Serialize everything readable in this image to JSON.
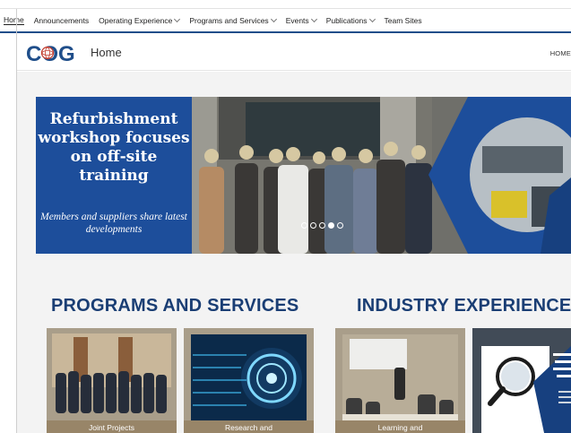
{
  "topnav": {
    "items": [
      {
        "label": "Home",
        "dropdown": false
      },
      {
        "label": "Announcements",
        "dropdown": false
      },
      {
        "label": "Operating Experience",
        "dropdown": true
      },
      {
        "label": "Programs and Services",
        "dropdown": true
      },
      {
        "label": "Events",
        "dropdown": true
      },
      {
        "label": "Publications",
        "dropdown": true
      },
      {
        "label": "Team Sites",
        "dropdown": false
      }
    ]
  },
  "header": {
    "logo_text": "COG",
    "title": "Home",
    "right_link": "HOME"
  },
  "hero": {
    "headline": "Refurbishment workshop focuses on off-site training",
    "subline": "Members and suppliers share latest developments",
    "slide_count": 5,
    "active_slide": 4
  },
  "sections": {
    "programs_title": "PROGRAMS AND SERVICES",
    "industry_title": "INDUSTRY EXPERIENCE"
  },
  "cards": [
    {
      "caption": "Joint Projects"
    },
    {
      "caption": "Research and"
    },
    {
      "caption": "Learning and"
    }
  ],
  "colors": {
    "brand_blue": "#1d4e9b",
    "nav_underline": "#1f4e8a",
    "section_title": "#1a3e74"
  }
}
